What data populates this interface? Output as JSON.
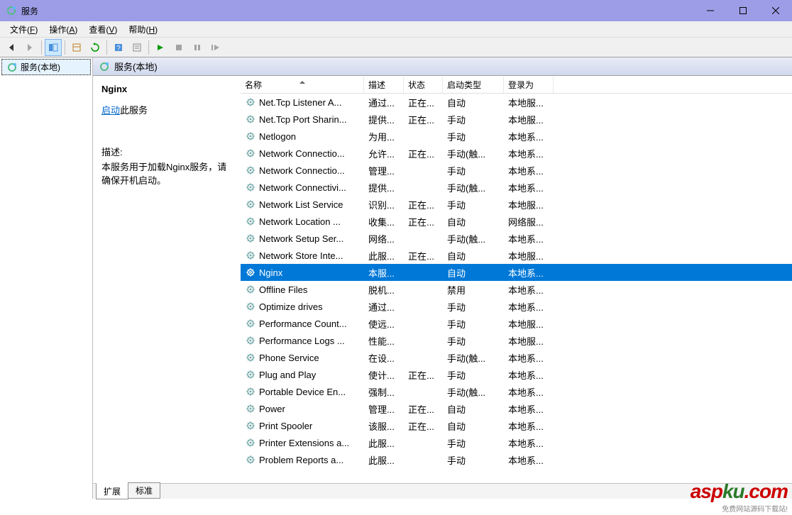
{
  "window": {
    "title": "服务"
  },
  "menu": {
    "file": "文件",
    "file_k": "F",
    "action": "操作",
    "action_k": "A",
    "view": "查看",
    "view_k": "V",
    "help": "帮助",
    "help_k": "H"
  },
  "tree": {
    "root": "服务(本地)"
  },
  "header": {
    "label": "服务(本地)"
  },
  "detail": {
    "name": "Nginx",
    "start_link": "启动",
    "start_suffix": "此服务",
    "desc_label": "描述:",
    "desc_text": "本服务用于加载Nginx服务，请确保开机启动。"
  },
  "columns": {
    "name": "名称",
    "desc": "描述",
    "status": "状态",
    "startup": "启动类型",
    "logon": "登录为"
  },
  "services": [
    {
      "name": "Net.Tcp Listener A...",
      "desc": "通过...",
      "status": "正在...",
      "startup": "自动",
      "logon": "本地服..."
    },
    {
      "name": "Net.Tcp Port Sharin...",
      "desc": "提供...",
      "status": "正在...",
      "startup": "手动",
      "logon": "本地服..."
    },
    {
      "name": "Netlogon",
      "desc": "为用...",
      "status": "",
      "startup": "手动",
      "logon": "本地系..."
    },
    {
      "name": "Network Connectio...",
      "desc": "允许...",
      "status": "正在...",
      "startup": "手动(触...",
      "logon": "本地系..."
    },
    {
      "name": "Network Connectio...",
      "desc": "管理...",
      "status": "",
      "startup": "手动",
      "logon": "本地系..."
    },
    {
      "name": "Network Connectivi...",
      "desc": "提供...",
      "status": "",
      "startup": "手动(触...",
      "logon": "本地系..."
    },
    {
      "name": "Network List Service",
      "desc": "识别...",
      "status": "正在...",
      "startup": "手动",
      "logon": "本地服..."
    },
    {
      "name": "Network Location ...",
      "desc": "收集...",
      "status": "正在...",
      "startup": "自动",
      "logon": "网络服..."
    },
    {
      "name": "Network Setup Ser...",
      "desc": "网络...",
      "status": "",
      "startup": "手动(触...",
      "logon": "本地系..."
    },
    {
      "name": "Network Store Inte...",
      "desc": "此服...",
      "status": "正在...",
      "startup": "自动",
      "logon": "本地服..."
    },
    {
      "name": "Nginx",
      "desc": "本服...",
      "status": "",
      "startup": "自动",
      "logon": "本地系...",
      "selected": true
    },
    {
      "name": "Offline Files",
      "desc": "脱机...",
      "status": "",
      "startup": "禁用",
      "logon": "本地系..."
    },
    {
      "name": "Optimize drives",
      "desc": "通过...",
      "status": "",
      "startup": "手动",
      "logon": "本地系..."
    },
    {
      "name": "Performance Count...",
      "desc": "使远...",
      "status": "",
      "startup": "手动",
      "logon": "本地服..."
    },
    {
      "name": "Performance Logs ...",
      "desc": "性能...",
      "status": "",
      "startup": "手动",
      "logon": "本地服..."
    },
    {
      "name": "Phone Service",
      "desc": "在设...",
      "status": "",
      "startup": "手动(触...",
      "logon": "本地系..."
    },
    {
      "name": "Plug and Play",
      "desc": "使计...",
      "status": "正在...",
      "startup": "手动",
      "logon": "本地系..."
    },
    {
      "name": "Portable Device En...",
      "desc": "强制...",
      "status": "",
      "startup": "手动(触...",
      "logon": "本地系..."
    },
    {
      "name": "Power",
      "desc": "管理...",
      "status": "正在...",
      "startup": "自动",
      "logon": "本地系..."
    },
    {
      "name": "Print Spooler",
      "desc": "该服...",
      "status": "正在...",
      "startup": "自动",
      "logon": "本地系..."
    },
    {
      "name": "Printer Extensions a...",
      "desc": "此服...",
      "status": "",
      "startup": "手动",
      "logon": "本地系..."
    },
    {
      "name": "Problem Reports a...",
      "desc": "此服...",
      "status": "",
      "startup": "手动",
      "logon": "本地系..."
    }
  ],
  "tabs": {
    "ext": "扩展",
    "std": "标准"
  },
  "watermark": {
    "text1": "asp",
    "text2": "ku",
    "text3": ".com",
    "sub": "免费网站源码下载站!"
  }
}
